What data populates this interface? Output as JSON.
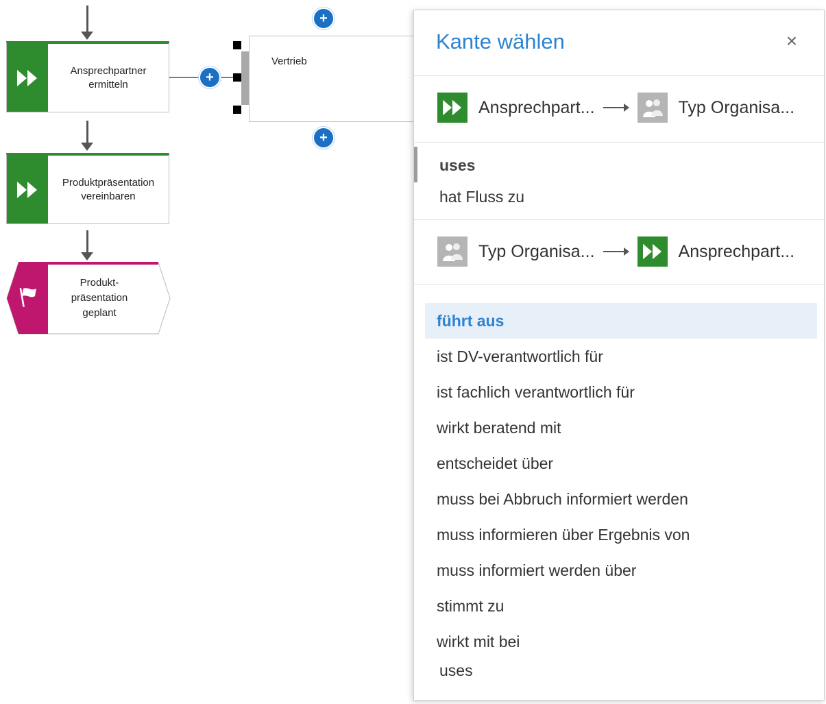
{
  "diagram": {
    "function1_label": "Ansprechpartner\nermitteln",
    "function2_label": "Produktpräsentation\nvereinbaren",
    "event_label": "Produkt-\npräsentation\ngeplant",
    "org_label": "Vertrieb",
    "colors": {
      "function_green": "#2e8b2e",
      "event_magenta": "#c0176e",
      "plus_blue": "#1b6fc4"
    }
  },
  "panel": {
    "title": "Kante wählen",
    "close_icon": "×",
    "direction1": {
      "from": "Ansprechpart...",
      "to": "Typ Organisa...",
      "options": [
        "uses",
        "hat Fluss zu"
      ]
    },
    "direction2": {
      "from": "Typ Organisa...",
      "to": "Ansprechpart...",
      "selected": "führt aus",
      "options": [
        "ist DV-verantwortlich für",
        "ist fachlich verantwortlich für",
        "wirkt beratend mit",
        "entscheidet über",
        "muss bei Abbruch informiert werden",
        "muss informieren über Ergebnis von",
        "muss informiert werden über",
        "stimmt zu",
        "wirkt mit bei"
      ],
      "last_option": "uses"
    },
    "colors": {
      "title_blue": "#2d83d1",
      "selected_bg": "#e7f0f9"
    }
  }
}
